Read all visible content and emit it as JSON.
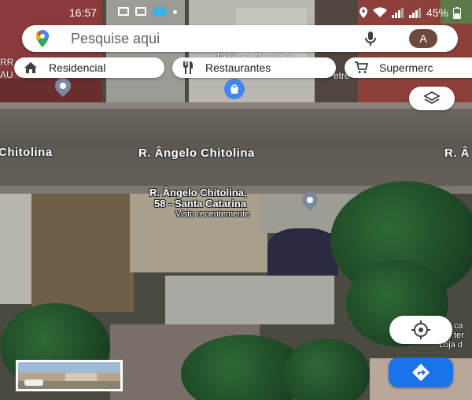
{
  "status_bar": {
    "time": "16:57",
    "battery": "45%"
  },
  "search": {
    "placeholder": "Pesquise aqui",
    "avatar_letter": "A"
  },
  "chips": [
    {
      "label": "Residencial",
      "icon": "home-icon"
    },
    {
      "label": "Restaurantes",
      "icon": "fork-knife-icon"
    },
    {
      "label": "Supermerc",
      "icon": "cart-icon"
    }
  ],
  "map": {
    "street_left": "Chitolina",
    "street_center": "R. Ângelo Chitolina",
    "street_right": "R. Â",
    "poi_top": "Produce Produtos",
    "poi_top_left": "RR",
    "poi_top_left2": "AU",
    "poi_top_right": "etre",
    "selected_place_line1": "R. Ângelo Chitolina,",
    "selected_place_line2": "58 - Santa Catarina",
    "selected_place_sub": "Visto recentemente",
    "right_label_1": "ca",
    "right_label_2": "ter",
    "right_label_3": "Loja d"
  },
  "colors": {
    "accent_blue": "#1a73e8",
    "pin_blue": "#4285f4",
    "pin_gray": "#7b8aa0"
  }
}
